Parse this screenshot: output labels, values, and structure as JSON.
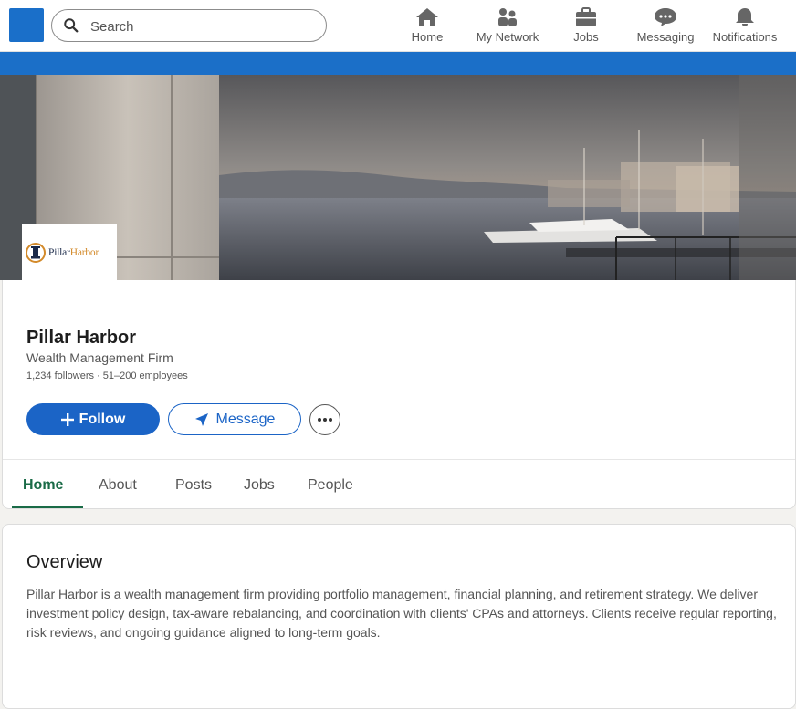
{
  "nav": {
    "search_placeholder": "Search",
    "items": [
      {
        "label": "Home",
        "icon": "home-icon"
      },
      {
        "label": "My Network",
        "icon": "network-icon"
      },
      {
        "label": "Jobs",
        "icon": "briefcase-icon"
      },
      {
        "label": "Messaging",
        "icon": "messaging-icon"
      },
      {
        "label": "Notifications",
        "icon": "bell-icon"
      }
    ],
    "accent_color": "#1b6fc8"
  },
  "company": {
    "logo_text_part1": "Pillar",
    "logo_text_part2": "Harbor",
    "name": "Pillar Harbor",
    "tagline": "Wealth Management Firm",
    "meta": "1,234 followers · 51–200 employees"
  },
  "actions": {
    "follow_label": "Follow",
    "message_label": "Message"
  },
  "tabs": [
    {
      "label": "Home",
      "active": true
    },
    {
      "label": "About",
      "active": false
    },
    {
      "label": "Posts",
      "active": false
    },
    {
      "label": "Jobs",
      "active": false
    },
    {
      "label": "People",
      "active": false
    }
  ],
  "overview": {
    "title": "Overview",
    "body": "Pillar Harbor is a wealth management firm providing portfolio management, financial planning, and retirement strategy. We deliver investment policy design, tax-aware rebalancing, and coordination with clients' CPAs and attorneys. Clients receive regular reporting, risk reviews, and ongoing guidance aligned to long-term goals."
  },
  "colors": {
    "primary_button": "#1b64c6",
    "active_tab": "#1a6b47"
  }
}
